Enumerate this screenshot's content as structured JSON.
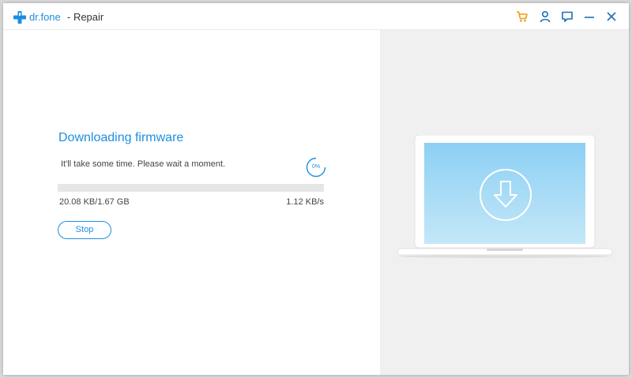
{
  "app": {
    "brand": "dr.fone",
    "title": "- Repair"
  },
  "titlebar": {
    "icons": [
      "cart-icon",
      "user-icon",
      "feedback-icon",
      "minimize-icon",
      "close-icon"
    ],
    "cart_color": "#f39c12",
    "icon_color": "#1d8fe0"
  },
  "download": {
    "heading": "Downloading firmware",
    "message": "It'll take some time. Please wait a moment.",
    "percent_label": "0%",
    "progress_fraction": 0,
    "size_label": "20.08 KB/1.67 GB",
    "speed_label": "1.12 KB/s",
    "stop_label": "Stop"
  },
  "illustration": {
    "icon": "download-arrow-icon",
    "screen_color": "#8fd0f2"
  },
  "colors": {
    "accent": "#1d8fe0",
    "panel_bg": "#f0f0f0"
  }
}
